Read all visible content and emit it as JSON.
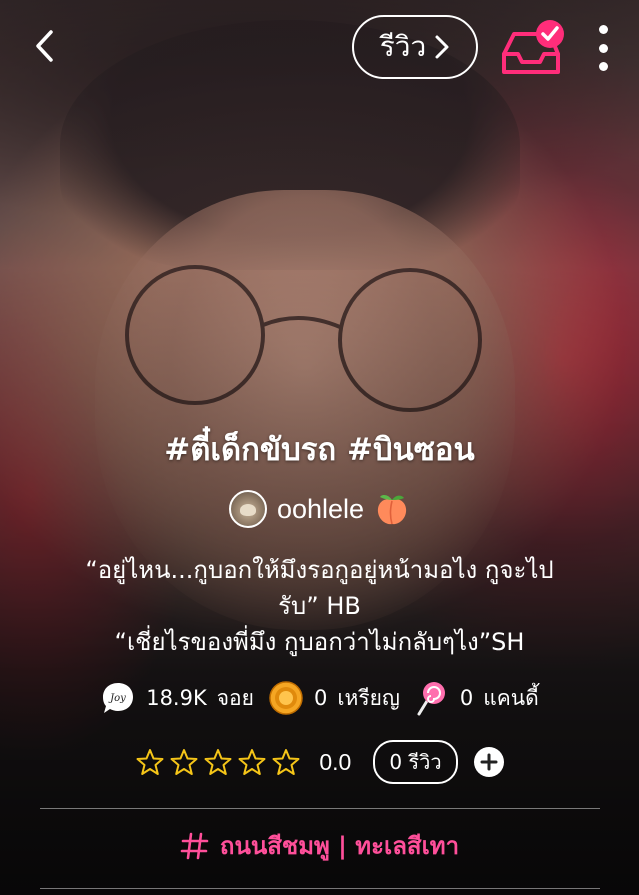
{
  "topbar": {
    "back_icon": "chevron-left-icon",
    "review_label": "รีวิว",
    "review_chevron_icon": "chevron-right-icon",
    "inbox_icon": "inbox-check-icon",
    "more_icon": "more-vertical-icon",
    "accent_color": "#ff2d7a"
  },
  "story": {
    "title": "#ตี๋เด็กขับรถ #บินซอน",
    "author": {
      "name": "oohlele",
      "avatar_icon": "cat-avatar",
      "badge_icon": "peach-icon"
    },
    "quote_lines": [
      "“อยู่ไหน...กูบอกให้มึงรอกูอยู่หน้ามอไง กูจะไป",
      "รับ” HB",
      "“เชี่ยไรของพี่มึง กูบอกว่าไม่กลับๆไง”SH"
    ]
  },
  "stats": {
    "joy": {
      "icon": "joy-icon",
      "value": "18.9K",
      "label": "จอย"
    },
    "coin": {
      "icon": "coin-icon",
      "value": "0",
      "label": "เหรียญ"
    },
    "candy": {
      "icon": "lollipop-icon",
      "value": "0",
      "label": "แคนดี้"
    }
  },
  "rating": {
    "stars": 0,
    "max_stars": 5,
    "value": "0.0",
    "review_count_label": "0 รีวิว",
    "add_icon": "plus-circle-icon",
    "star_color": "#f5c518"
  },
  "category": {
    "icon": "hashtag-icon",
    "label": "ถนนสีชมพู | ทะเลสีเทา",
    "color": "#ff4f9a"
  }
}
